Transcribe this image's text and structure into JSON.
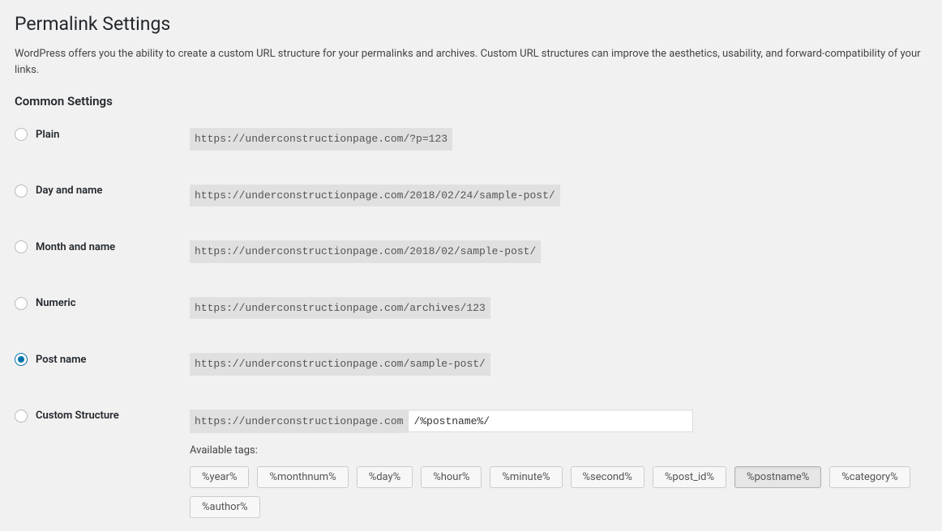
{
  "page": {
    "title": "Permalink Settings",
    "description": "WordPress offers you the ability to create a custom URL structure for your permalinks and archives. Custom URL structures can improve the aesthetics, usability, and forward-compatibility of your links."
  },
  "common_settings": {
    "heading": "Common Settings",
    "selected": "post_name",
    "options": {
      "plain": {
        "label": "Plain",
        "example": "https://underconstructionpage.com/?p=123"
      },
      "day_name": {
        "label": "Day and name",
        "example": "https://underconstructionpage.com/2018/02/24/sample-post/"
      },
      "month_name": {
        "label": "Month and name",
        "example": "https://underconstructionpage.com/2018/02/sample-post/"
      },
      "numeric": {
        "label": "Numeric",
        "example": "https://underconstructionpage.com/archives/123"
      },
      "post_name": {
        "label": "Post name",
        "example": "https://underconstructionpage.com/sample-post/"
      },
      "custom": {
        "label": "Custom Structure",
        "base_url": "https://underconstructionpage.com",
        "structure_value": "/%postname%/",
        "available_tags_label": "Available tags:",
        "tags": [
          "%year%",
          "%monthnum%",
          "%day%",
          "%hour%",
          "%minute%",
          "%second%",
          "%post_id%",
          "%postname%",
          "%category%",
          "%author%"
        ],
        "active_tag": "%postname%"
      }
    }
  }
}
